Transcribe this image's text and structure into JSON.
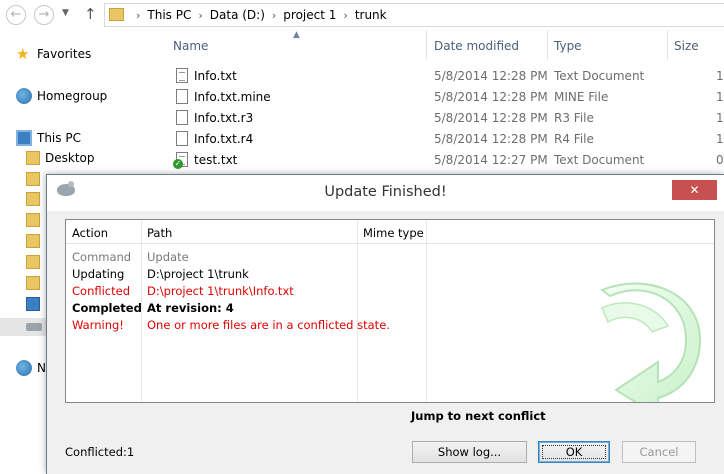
{
  "explorer": {
    "breadcrumb": [
      "This PC",
      "Data (D:)",
      "project 1",
      "trunk"
    ],
    "sidebar": {
      "favorites": "Favorites",
      "homegroup": "Homegroup",
      "this_pc": "This PC",
      "desktop": "Desktop",
      "network_partial": "N"
    },
    "columns": {
      "name": "Name",
      "date": "Date modified",
      "type": "Type",
      "size": "Size"
    },
    "files": [
      {
        "name": "Info.txt",
        "date": "5/8/2014 12:28 PM",
        "type": "Text Document",
        "size": "1"
      },
      {
        "name": "Info.txt.mine",
        "date": "5/8/2014 12:28 PM",
        "type": "MINE File",
        "size": "1"
      },
      {
        "name": "Info.txt.r3",
        "date": "5/8/2014 12:28 PM",
        "type": "R3 File",
        "size": "1"
      },
      {
        "name": "Info.txt.r4",
        "date": "5/8/2014 12:28 PM",
        "type": "R4 File",
        "size": "1"
      },
      {
        "name": "test.txt",
        "date": "5/8/2014 12:27 PM",
        "type": "Text Document",
        "size": "0"
      }
    ]
  },
  "dialog": {
    "title": "Update Finished!",
    "close_glyph": "✕",
    "minimize_glyph": "—",
    "columns": {
      "action": "Action",
      "path": "Path",
      "mime": "Mime type"
    },
    "rows": [
      {
        "action": "Command",
        "path": "Update",
        "style": "gray"
      },
      {
        "action": "Updating",
        "path": "D:\\project 1\\trunk",
        "style": "normal"
      },
      {
        "action": "Conflicted",
        "path": "D:\\project 1\\trunk\\Info.txt",
        "style": "red"
      },
      {
        "action": "Completed",
        "path": "At revision: 4",
        "style": "bold"
      },
      {
        "action": "Warning!",
        "path": "One or more files are in a conflicted state.",
        "style": "red"
      }
    ],
    "jump_label": "Jump to next conflict",
    "status": "Conflicted:1",
    "buttons": {
      "show_log": "Show log...",
      "ok": "OK",
      "cancel": "Cancel"
    },
    "accent_color": "#c75050"
  }
}
